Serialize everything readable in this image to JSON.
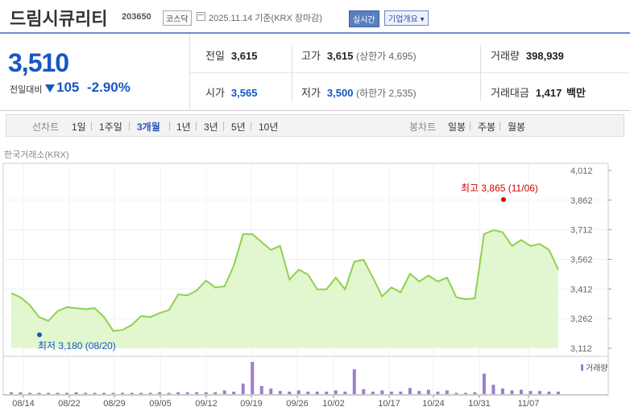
{
  "header": {
    "name": "드림시큐리티",
    "code": "203650",
    "market": "코스닥",
    "date": "2025.11.14 기준(KRX 장마감)",
    "realtime": "실시간",
    "corp_info": "기업개요 ▾"
  },
  "quote": {
    "price": "3,510",
    "change_label": "전일대비",
    "change": "105",
    "change_pct": "-2.90%",
    "prev_label": "전일",
    "prev": "3,615",
    "open_label": "시가",
    "open": "3,565",
    "high_label": "고가",
    "high": "3,615",
    "upper_limit": "(상한가 4,695)",
    "low_label": "저가",
    "low": "3,500",
    "lower_limit": "(하한가 2,535)",
    "volume_label": "거래량",
    "volume": "398,939",
    "amount_label": "거래대금",
    "amount": "1,417",
    "amount_unit": "백만"
  },
  "tabs": {
    "line_label": "선차트",
    "periods": [
      "1일",
      "1주일",
      "3개월",
      "1년",
      "3년",
      "5년",
      "10년"
    ],
    "selected_period": "3개월",
    "candle_label": "봉차트",
    "candles": [
      "일봉",
      "주봉",
      "월봉"
    ]
  },
  "colors": {
    "accent": "#1756c5",
    "line": "#8fd14f",
    "area": "#e2f6cf",
    "volume": "#9b7fd0",
    "high": "#d40000"
  },
  "chart_data": {
    "type": "area",
    "source_label": "한국거래소(KRX)",
    "y_ticks": [
      "4,012",
      "3,862",
      "3,712",
      "3,562",
      "3,412",
      "3,262",
      "3,112"
    ],
    "ylim": [
      3112,
      4012
    ],
    "x_tick_labels": [
      "08/14",
      "08/22",
      "08/29",
      "09/05",
      "09/12",
      "09/19",
      "09/26",
      "10/02",
      "10/17",
      "10/24",
      "10/31",
      "11/07"
    ],
    "high_annotation": "최고 3,865 (11/06)",
    "low_annotation": "최저 3,180 (08/20)",
    "volume_label": "거래량",
    "series": [
      {
        "values": [
          3390,
          3370,
          3330,
          3270,
          3250,
          3300,
          3320,
          3315,
          3310,
          3315,
          3270,
          3200,
          3205,
          3230,
          3275,
          3270,
          3290,
          3305,
          3385,
          3380,
          3405,
          3455,
          3420,
          3425,
          3530,
          3690,
          3690,
          3650,
          3610,
          3630,
          3460,
          3510,
          3485,
          3410,
          3410,
          3470,
          3410,
          3550,
          3560,
          3470,
          3375,
          3420,
          3395,
          3490,
          3450,
          3480,
          3450,
          3470,
          3370,
          3360,
          3365,
          3690,
          3710,
          3700,
          3630,
          3660,
          3630,
          3640,
          3610,
          3510
        ],
        "volume": [
          3,
          3,
          2,
          2,
          2,
          2,
          2,
          3,
          2,
          2,
          2,
          2,
          2,
          2,
          2,
          2,
          3,
          2,
          3,
          3,
          3,
          3,
          3,
          6,
          4,
          17,
          52,
          13,
          9,
          5,
          4,
          6,
          4,
          4,
          4,
          6,
          4,
          40,
          8,
          4,
          6,
          4,
          4,
          10,
          5,
          7,
          4,
          6,
          2,
          2,
          3,
          33,
          15,
          9,
          6,
          7,
          5,
          5,
          4,
          4
        ]
      }
    ]
  }
}
